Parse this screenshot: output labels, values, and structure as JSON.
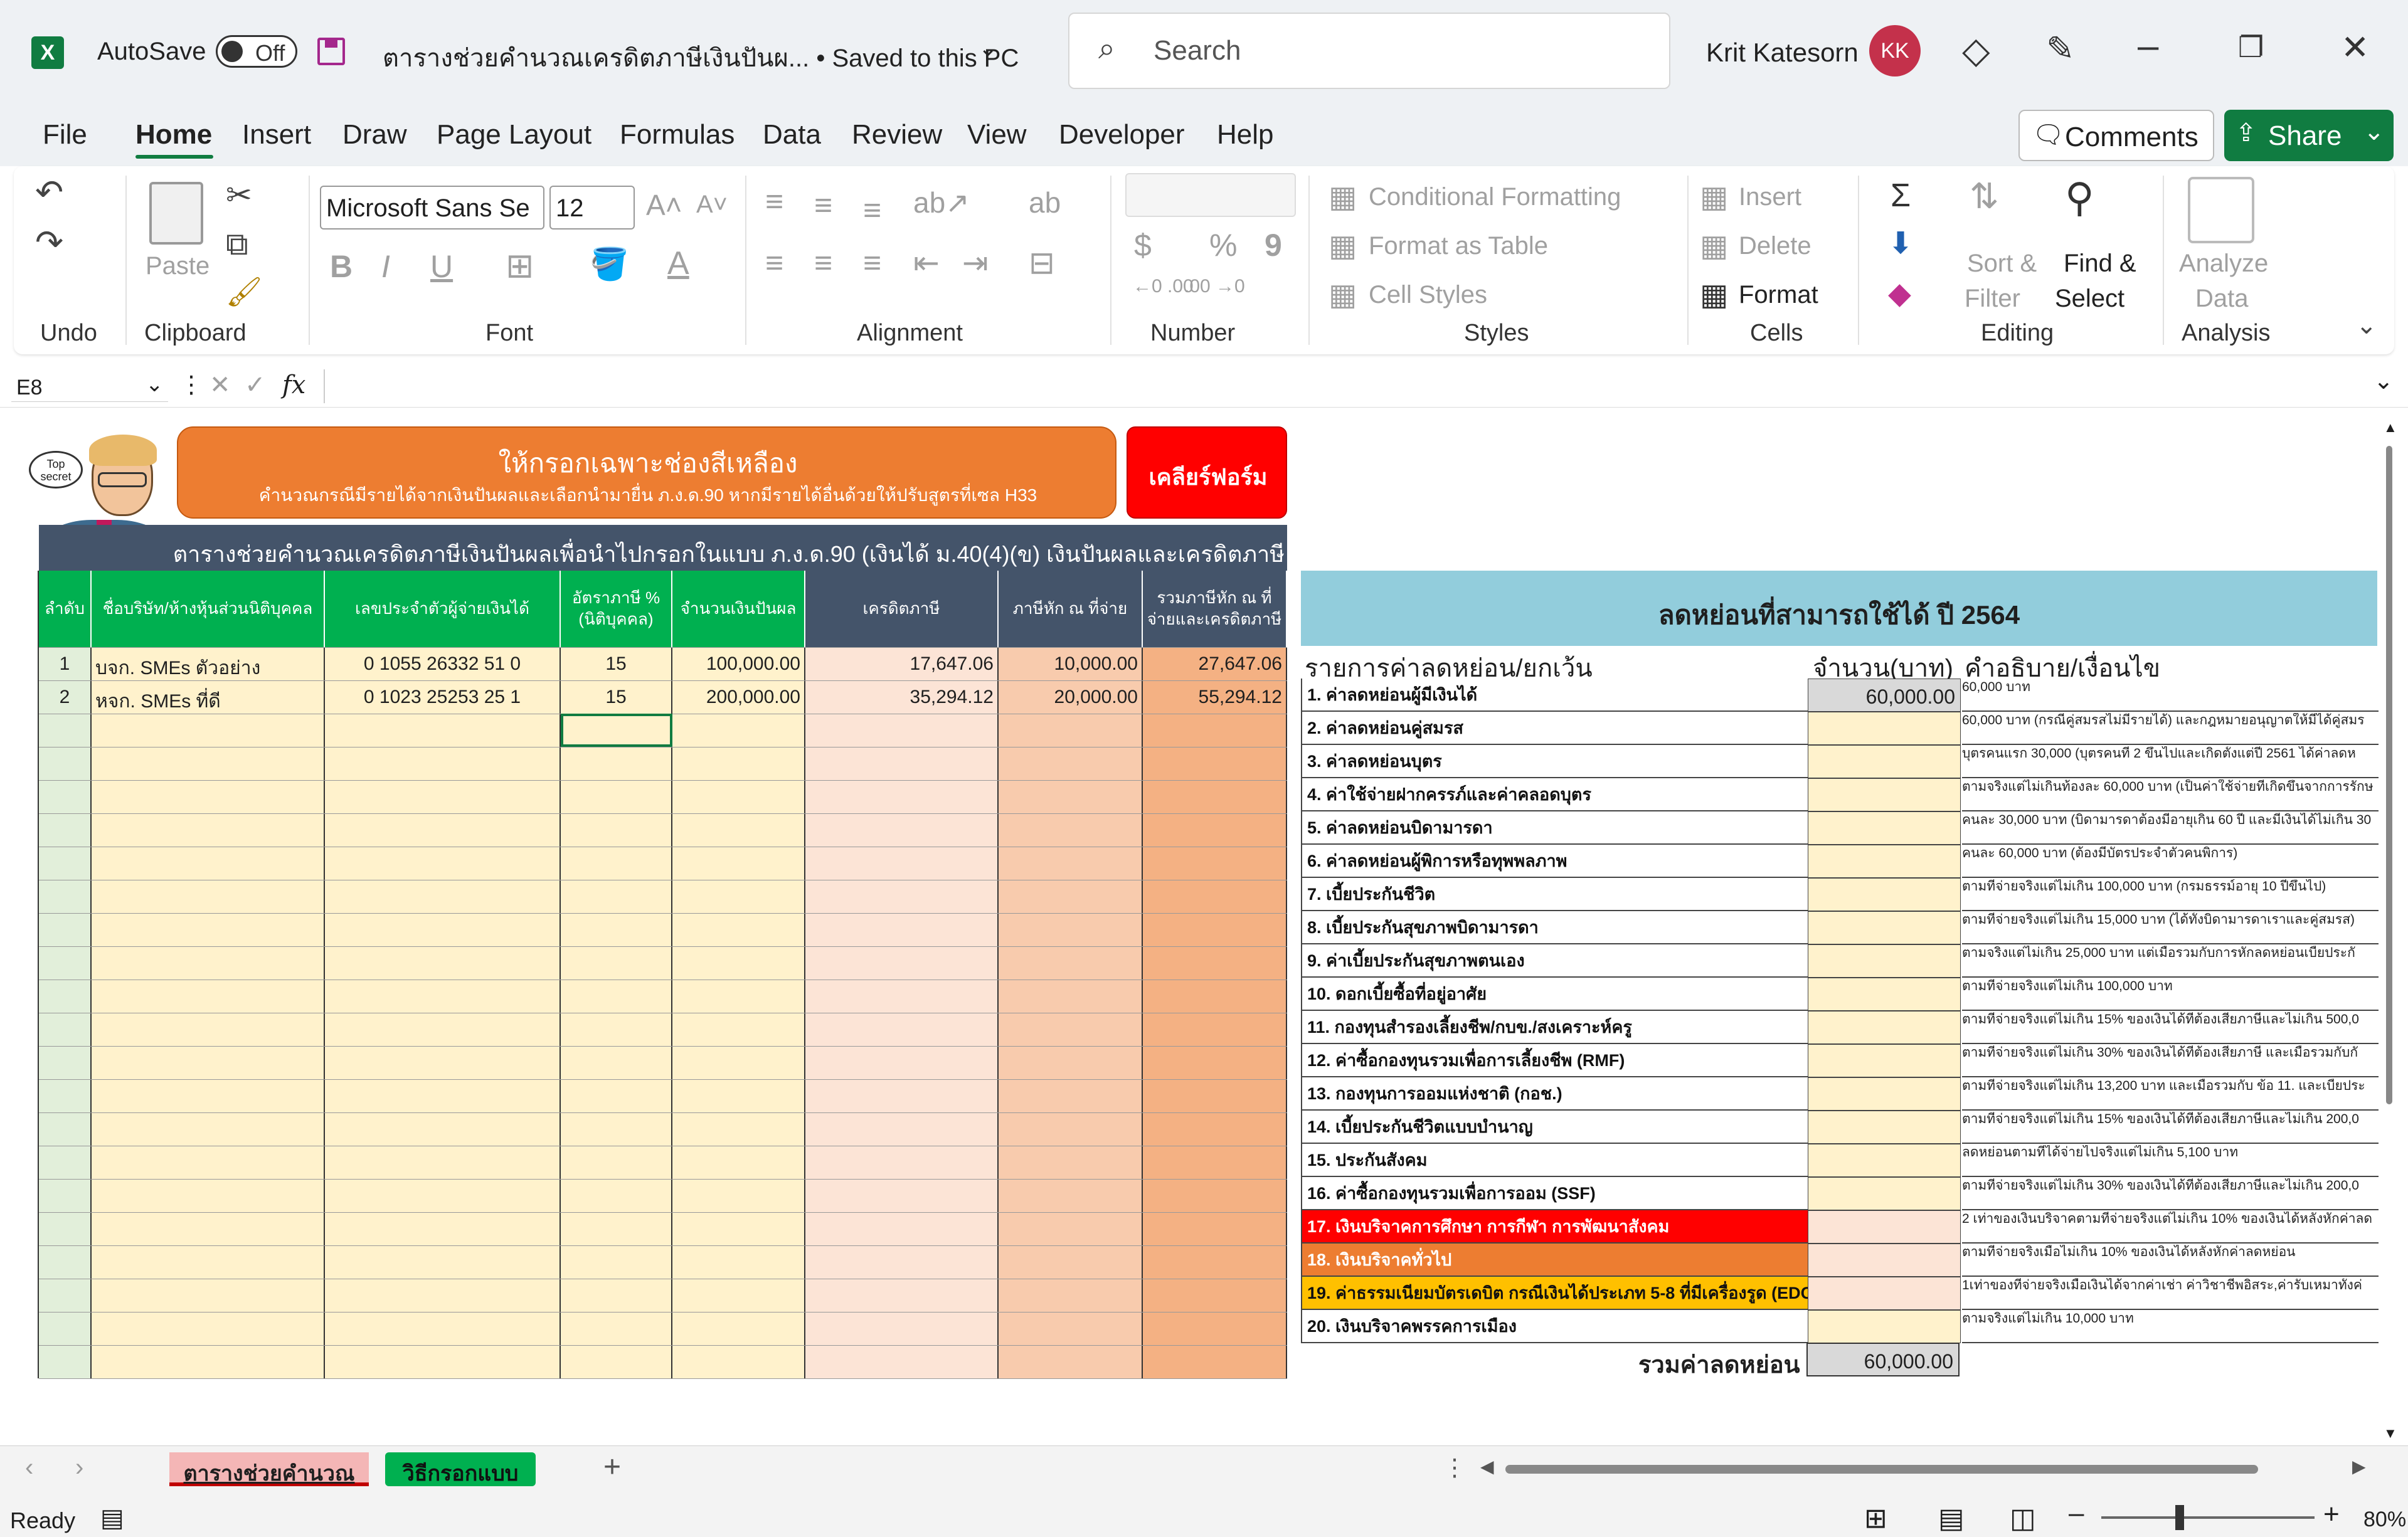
{
  "titlebar": {
    "autosave_label": "AutoSave",
    "toggle_label": "Off",
    "doc_title": "ตารางช่วยคำนวณเครดิตภาษีเงินปันผ... • Saved to this PC",
    "search_placeholder": "Search",
    "user_name": "Krit Katesorn",
    "user_initials": "KK"
  },
  "menu": {
    "tabs": [
      "File",
      "Home",
      "Insert",
      "Draw",
      "Page Layout",
      "Formulas",
      "Data",
      "Review",
      "View",
      "Developer",
      "Help"
    ],
    "active": "Home",
    "comments": "Comments",
    "share": "Share"
  },
  "ribbon": {
    "groups": {
      "undo": "Undo",
      "clipboard": "Clipboard",
      "font": "Font",
      "alignment": "Alignment",
      "number": "Number",
      "styles": "Styles",
      "cells": "Cells",
      "editing": "Editing",
      "analysis": "Analysis"
    },
    "paste": "Paste",
    "font_name": "Microsoft Sans Se",
    "font_size": "12",
    "bold": "B",
    "italic": "I",
    "underline": "U",
    "currency": "$",
    "percent": "%",
    "comma": "9",
    "cond_format": "Conditional Formatting",
    "format_table": "Format as Table",
    "cell_styles": "Cell Styles",
    "insert": "Insert",
    "delete": "Delete",
    "format": "Format",
    "sort_filter": "Sort & Filter",
    "sort_l1": "Sort &",
    "sort_l2": "Filter",
    "find_l1": "Find &",
    "find_l2": "Select",
    "analyze_l1": "Analyze",
    "analyze_l2": "Data"
  },
  "formula_bar": {
    "name_box": "E8",
    "fx": "fx",
    "formula": ""
  },
  "sheet": {
    "banner_title": "ให้กรอกเฉพาะช่องสีเหลือง",
    "banner_sub": "คำนวณกรณีมีรายได้จากเงินปันผลและเลือกนำมายื่น ภ.ง.ด.90 หากมีรายได้อื่นด้วยให้ปรับสูตรที่เซล H33",
    "clear_btn": "เคลียร์ฟอร์ม",
    "character_bubble": "Top secret",
    "dark_banner": "ตารางช่วยคำนวณเครดิตภาษีเงินปันผลเพื่อนำไปกรอกในแบบ ภ.ง.ด.90 (เงินได้ ม.40(4)(ข) เงินปันผลและเครดิตภาษี",
    "headers": [
      "ลำดับ",
      "ชื่อบริษัท/ห้างหุ้นส่วนนิติบุคคล",
      "เลขประจำตัวผู้จ่ายเงินได้",
      "อัตราภาษี % (นิติบุคคล)",
      "จำนวนเงินปันผล",
      "เครดิตภาษี",
      "ภาษีหัก ณ ที่จ่าย",
      "รวมภาษีหัก ณ ที่จ่ายและเครดิตภาษี"
    ],
    "rows": [
      [
        "1",
        "บจก. SMEs ตัวอย่าง",
        "0 1055 26332 51 0",
        "15",
        "100,000.00",
        "17,647.06",
        "10,000.00",
        "27,647.06"
      ],
      [
        "2",
        "หจก. SMEs ที่ดี",
        "0 1023 25253 25 1",
        "15",
        "200,000.00",
        "35,294.12",
        "20,000.00",
        "55,294.12"
      ]
    ],
    "deduct_title": "ลดหย่อนที่สามารถใช้ได้ ปี 2564",
    "deduct_col1": "รายการค่าลดหย่อน/ยกเว้น",
    "deduct_col2": "จำนวน(บาท)",
    "deduct_col3": "คำอธิบาย/เงื่อนไข",
    "deductions": [
      {
        "label": "1. ค่าลดหย่อนผู้มีเงินได้",
        "amount": "60,000.00",
        "note": "60,000 บาท"
      },
      {
        "label": "2. ค่าลดหย่อนคู่สมรส",
        "amount": "",
        "note": "60,000 บาท (กรณีคู่สมรสไม่มีรายได้) และกฎหมายอนุญาตให้มีได้คู่สมร"
      },
      {
        "label": "3. ค่าลดหย่อนบุตร",
        "amount": "",
        "note": "บุตรคนแรก 30,000 (บุตรคนที่ 2 ขึ้นไปและเกิดตั้งแต่ปี 2561 ได้ค่าลดห"
      },
      {
        "label": "4. ค่าใช้จ่ายฝากครรภ์และค่าคลอดบุตร",
        "amount": "",
        "note": "ตามจริงแต่ไม่เกินท้องละ 60,000 บาท (เป็นค่าใช้จ่ายที่เกิดขึ้นจากการรักษ"
      },
      {
        "label": "5. ค่าลดหย่อนบิดามารดา",
        "amount": "",
        "note": "คนละ 30,000 บาท (บิดามารดาต้องมีอายุเกิน 60 ปี และมีเงินได้ไม่เกิน 30"
      },
      {
        "label": "6. ค่าลดหย่อนผู้พิการหรือทุพพลภาพ",
        "amount": "",
        "note": "คนละ 60,000 บาท (ต้องมีบัตรประจำตัวคนพิการ)"
      },
      {
        "label": "7. เบี้ยประกันชีวิต",
        "amount": "",
        "note": "ตามที่จ่ายจริงแต่ไม่เกิน 100,000 บาท (กรมธรรม์อายุ 10 ปีขึ้นไป)"
      },
      {
        "label": "8. เบี้ยประกันสุขภาพบิดามารดา",
        "amount": "",
        "note": "ตามที่จ่ายจริงแต่ไม่เกิน 15,000 บาท (ได้ทั้งบิดามารดาเราและคู่สมรส)"
      },
      {
        "label": "9. ค่าเบี้ยประกันสุขภาพตนเอง",
        "amount": "",
        "note": "ตามจริงแต่ไม่เกิน 25,000 บาท แต่เมื่อรวมกับการหักลดหย่อนเบี้ยประกั"
      },
      {
        "label": "10. ดอกเบี้ยซื้อที่อยู่อาศัย",
        "amount": "",
        "note": "ตามที่จ่ายจริงแต่ไม่เกิน 100,000 บาท"
      },
      {
        "label": "11. กองทุนสำรองเลี้ยงชีพ/กบข./สงเคราะห์ครู",
        "amount": "",
        "note": "ตามที่จ่ายจริงแต่ไม่เกิน 15% ของเงินได้ที่ต้องเสียภาษีและไม่เกิน 500,0"
      },
      {
        "label": "12. ค่าซื้อกองทุนรวมเพื่อการเลี้ยงชีพ (RMF)",
        "amount": "",
        "note": "ตามที่จ่ายจริงแต่ไม่เกิน 30% ของเงินได้ที่ต้องเสียภาษี และเมื่อรวมกับกั"
      },
      {
        "label": "13. กองทุนการออมแห่งชาติ (กอช.)",
        "amount": "",
        "note": "ตามที่จ่ายจริงแต่ไม่เกิน 13,200 บาท และเมื่อรวมกับ ข้อ 11. และเบี้ยประ"
      },
      {
        "label": "14. เบี้ยประกันชีวิตแบบบำนาญ",
        "amount": "",
        "note": "ตามที่จ่ายจริงแต่ไม่เกิน 15% ของเงินได้ที่ต้องเสียภาษีและไม่เกิน 200,0"
      },
      {
        "label": "15. ประกันสังคม",
        "amount": "",
        "note": "ลดหย่อนตามที่ได้จ่ายไปจริงแต่ไม่เกิน 5,100 บาท"
      },
      {
        "label": "16. ค่าซื้อกองทุนรวมเพื่อการออม (SSF)",
        "amount": "",
        "note": "ตามที่จ่ายจริงแต่ไม่เกิน 30% ของเงินได้ที่ต้องเสียภาษีและไม่เกิน 200,0"
      },
      {
        "label": "17. เงินบริจาคการศึกษา การกีฬา การพัฒนาสังคม",
        "amount": "",
        "note": "2 เท่าของเงินบริจาคตามที่จ่ายจริงแต่ไม่เกิน 10% ของเงินได้หลังหักค่าลด"
      },
      {
        "label": "18. เงินบริจาคทั่วไป",
        "amount": "",
        "note": "ตามที่จ่ายจริงเมื่อไม่เกิน 10% ของเงินได้หลังหักค่าลดหย่อน"
      },
      {
        "label": "19. ค่าธรรมเนียมบัตรเดบิต กรณีเงินได้ประเภท 5-8 ที่มีเครื่องรูด (EDC)",
        "amount": "",
        "note": "1เท่าของที่จ่ายจริงเมื่อเงินได้จากค่าเช่า ค่าวิชาชีพอิสระ,ค่ารับเหมาทั้งค่"
      },
      {
        "label": "20. เงินบริจาคพรรคการเมือง",
        "amount": "",
        "note": "ตามจริงแต่ไม่เกิน 10,000 บาท"
      }
    ],
    "total_label": "รวมค่าลดหย่อน",
    "total_value": "60,000.00"
  },
  "sheet_tabs": [
    "ตารางช่วยคำนวณ",
    "วิธีกรอกแบบ"
  ],
  "status": {
    "ready": "Ready",
    "zoom": "80%"
  },
  "colors": {
    "excel_green": "#107c41",
    "yellow": "#fff2cc",
    "orange_banner": "#ed7d31",
    "red": "#ff0000",
    "header_green": "#00b050",
    "navy": "#44546a",
    "light_blue": "#92cddc"
  }
}
